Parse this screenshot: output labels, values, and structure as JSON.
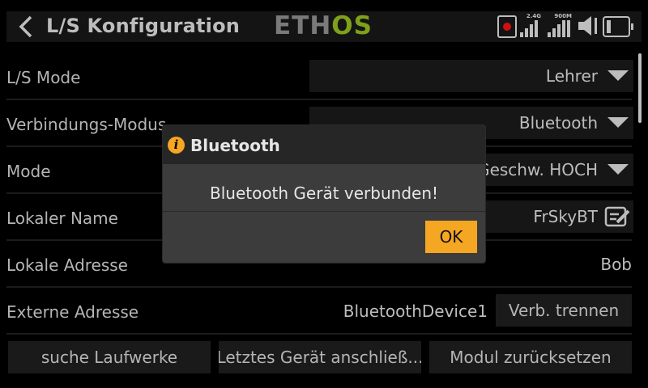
{
  "header": {
    "title": "L/S Konfiguration",
    "logo_part1": "ETH",
    "logo_part2": "OS",
    "logo_color_primary": "#7a7a7a",
    "logo_color_accent": "#7fa01a",
    "signal_24g_label": "2.4G",
    "signal_900m_label": "900M",
    "icons": [
      "back-icon",
      "record-icon",
      "signal-icon",
      "signal-icon",
      "speaker-icon",
      "battery-icon"
    ]
  },
  "settings": {
    "ls_mode": {
      "label": "L/S Mode",
      "value": "Lehrer"
    },
    "connection_mode": {
      "label": "Verbindungs-Modus",
      "value": "Bluetooth"
    },
    "mode": {
      "label": "Mode",
      "value": "Geschw. HOCH"
    },
    "local_name": {
      "label": "Lokaler Name",
      "value": "FrSkyBT"
    },
    "local_address": {
      "label": "Lokale Adresse",
      "value": "Bob"
    },
    "external_address": {
      "label": "Externe Adresse",
      "value": "BluetoothDevice1",
      "button": "Verb. trennen"
    }
  },
  "actions": {
    "search": "suche Laufwerke",
    "connect_last": "Letztes Gerät anschließ...",
    "reset": "Modul zurücksetzen"
  },
  "modal": {
    "title": "Bluetooth",
    "message": "Bluetooth Gerät verbunden!",
    "ok": "OK",
    "accent_color": "#f5a623"
  }
}
